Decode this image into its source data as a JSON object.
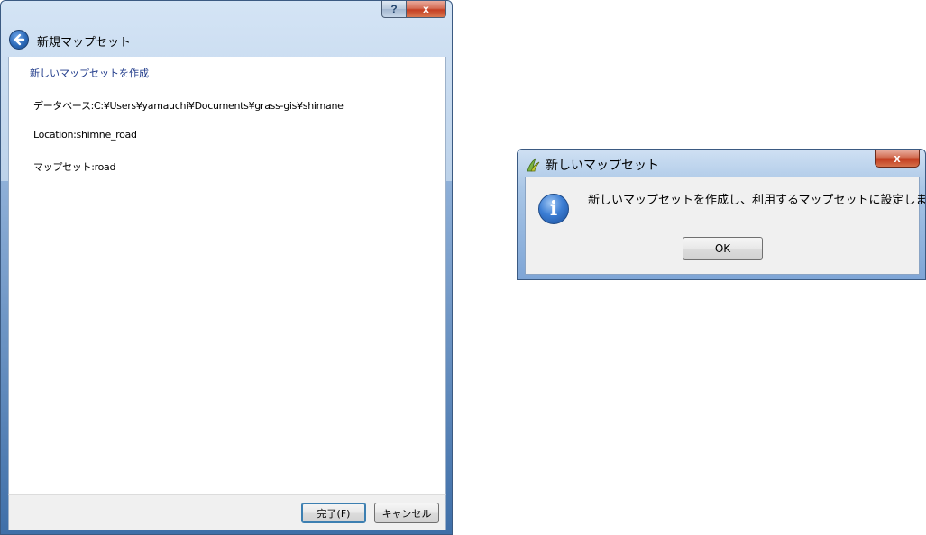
{
  "wizard": {
    "title": "新規マップセット",
    "help_button": "?",
    "close_button": "x",
    "heading": "新しいマップセットを作成",
    "lines": [
      "データベース:C:¥Users¥yamauchi¥Documents¥grass-gis¥shimane",
      "Location:shimne_road",
      "マップセット:road"
    ],
    "finish_label": "完了(F)",
    "cancel_label": "キャンセル"
  },
  "message_box": {
    "title": "新しいマップセット",
    "close_button": "x",
    "message": "新しいマップセットを作成し、利用するマップセットに設定しました。",
    "ok_label": "OK",
    "icon": "information-icon"
  },
  "colors": {
    "accent": "#1f3a8a",
    "frame": "#a9c3e2"
  }
}
